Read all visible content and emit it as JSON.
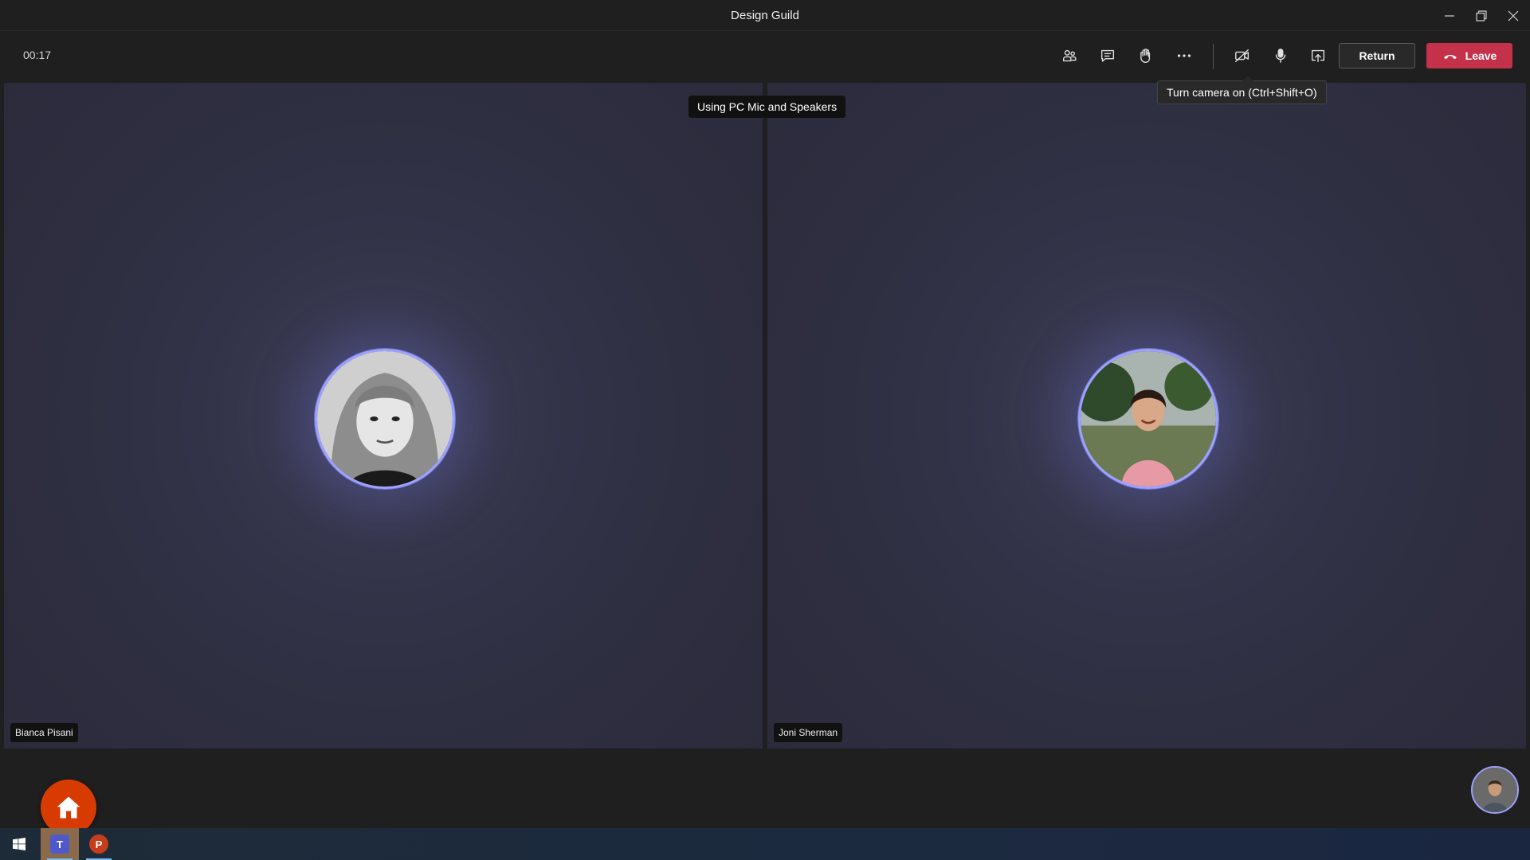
{
  "window": {
    "title": "Design Guild"
  },
  "toolbar": {
    "timer": "00:17",
    "return_label": "Return",
    "leave_label": "Leave",
    "icons": [
      "people-icon",
      "chat-icon",
      "raise-hand-icon",
      "more-options-icon",
      "camera-off-icon",
      "microphone-icon",
      "share-screen-icon"
    ]
  },
  "tooltips": {
    "camera": "Turn camera on (Ctrl+Shift+O)",
    "audio": "Using PC Mic and Speakers"
  },
  "participants": [
    {
      "name": "Bianca Pisani"
    },
    {
      "name": "Joni Sherman"
    }
  ],
  "colors": {
    "leave": "#c4314b",
    "avatar_ring": "#9ea2ff",
    "home": "#d83b01"
  }
}
